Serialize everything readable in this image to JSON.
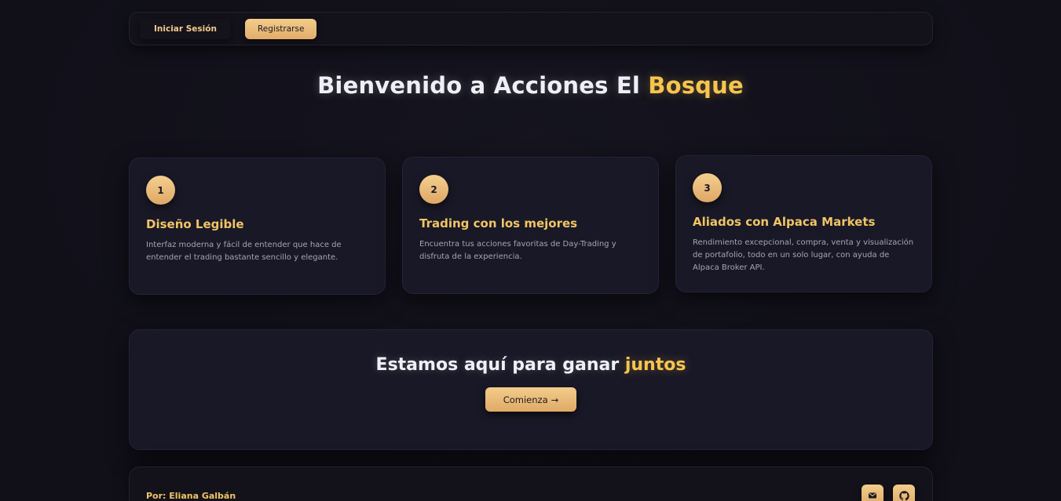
{
  "navbar": {
    "login_label": "Iniciar Sesión",
    "register_label": "Registrarse"
  },
  "hero": {
    "title_main": "Bienvenido a Acciones El ",
    "title_accent": "Bosque"
  },
  "features": [
    {
      "number": "1",
      "title": "Diseño Legible",
      "text": "Interfaz moderna y fácil de entender que hace de entender el trading bastante sencillo y elegante."
    },
    {
      "number": "2",
      "title": "Trading con los mejores",
      "text": "Encuentra tus acciones favoritas de Day-Trading y disfruta de la experiencia."
    },
    {
      "number": "3",
      "title": "Aliados con Alpaca Markets",
      "text": "Rendimiento excepcional, compra, venta y visualización de portafolio, todo en un solo lugar, con ayuda de Alpaca Broker API."
    }
  ],
  "cta": {
    "title_main": "Estamos aquí para ganar ",
    "title_accent": "juntos",
    "button_label": "Comienza",
    "button_arrow": "→"
  },
  "footer": {
    "author": "Por: Eliana Galbán",
    "icons": [
      "mail-icon",
      "github-icon"
    ]
  },
  "colors": {
    "background": "#111019",
    "card": "#191826",
    "accent_gold": "#f6c54f",
    "button_gold": "#f3cc8b"
  }
}
